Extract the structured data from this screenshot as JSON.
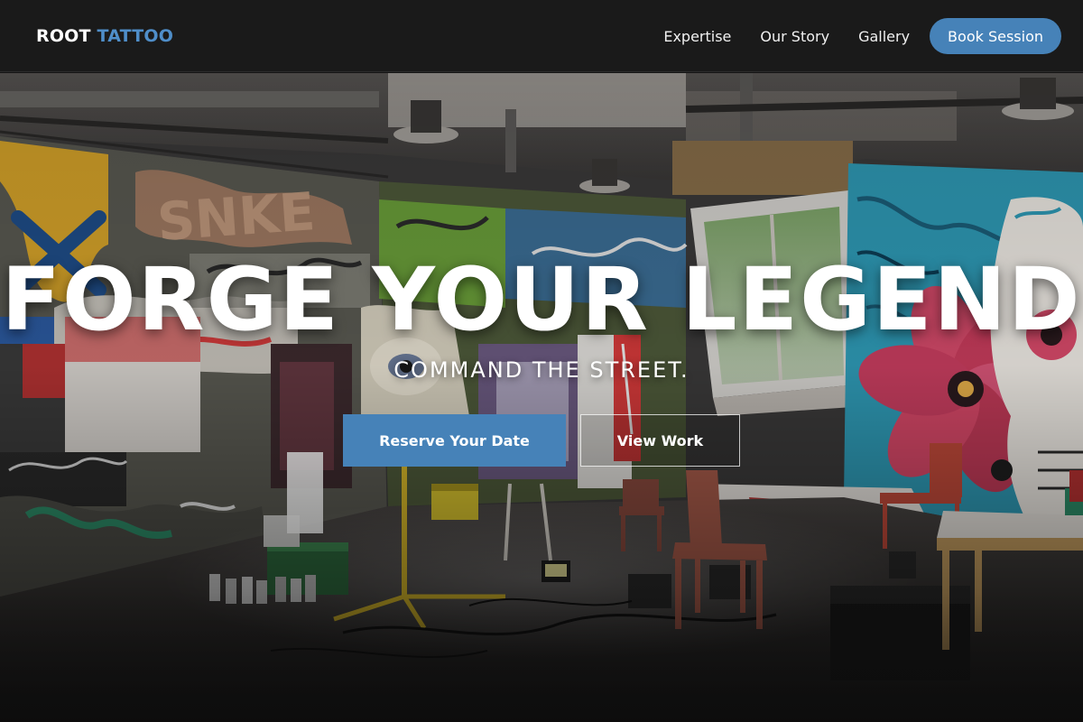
{
  "navbar": {
    "logo_primary": "ROOT",
    "logo_accent": "TATTOO",
    "links": [
      {
        "label": "Expertise"
      },
      {
        "label": "Our Story"
      },
      {
        "label": "Gallery"
      }
    ],
    "cta_label": "Book Session"
  },
  "hero": {
    "headline": "FORGE YOUR LEGEND",
    "subheadline": "COMMAND THE STREET.",
    "primary_button": "Reserve Your Date",
    "secondary_button": "View Work",
    "background": "graffiti-tattoo-studio-photo"
  },
  "colors": {
    "accent": "#4682b8",
    "logo_accent": "#4f8ec9",
    "navbar_bg": "#1a1a1a",
    "text": "#ffffff"
  }
}
